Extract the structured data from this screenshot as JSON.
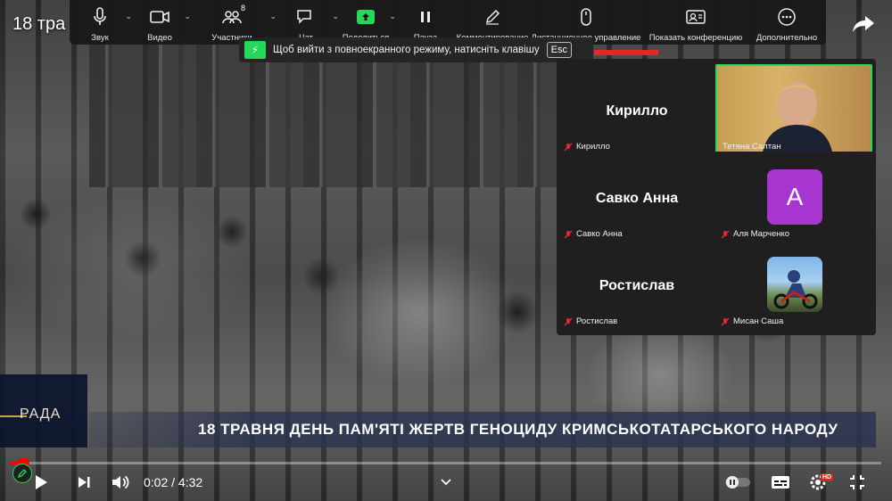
{
  "date_label": "18 тра",
  "toolbar": {
    "items": [
      {
        "label": "Звук",
        "icon": "microphone-icon"
      },
      {
        "label": "Видео",
        "icon": "camera-icon"
      },
      {
        "label": "Участники",
        "icon": "participants-icon",
        "badge": "8"
      },
      {
        "label": "Чат",
        "icon": "chat-icon"
      },
      {
        "label": "Поделиться",
        "icon": "share-screen-icon"
      },
      {
        "label": "Пауза",
        "icon": "pause-icon"
      },
      {
        "label": "Комментирование",
        "icon": "annotate-icon"
      },
      {
        "label": "Дистанционное управление",
        "icon": "remote-control-icon"
      },
      {
        "label": "Показать конференцию",
        "icon": "show-meeting-icon"
      },
      {
        "label": "Дополнительно",
        "icon": "more-icon"
      }
    ]
  },
  "fullscreen_hint": {
    "text": "Щоб вийти з повноекранного режиму, натисніть клавішу",
    "key": "Esc"
  },
  "participants": [
    {
      "display_name": "Кирилло",
      "caption": "Кирилло",
      "muted": true,
      "type": "name"
    },
    {
      "display_name": "",
      "caption": "Тетяна Салтан",
      "muted": false,
      "type": "video"
    },
    {
      "display_name": "Савко Анна",
      "caption": "Савко Анна",
      "muted": true,
      "type": "name"
    },
    {
      "display_name": "A",
      "caption": "Аля Марченко",
      "muted": true,
      "type": "avatar"
    },
    {
      "display_name": "Ростислав",
      "caption": "Ростислав",
      "muted": true,
      "type": "name"
    },
    {
      "display_name": "",
      "caption": "Мисан Саша",
      "muted": true,
      "type": "photo"
    }
  ],
  "lower_third": {
    "channel": "РАДА",
    "headline": "18 ТРАВНЯ ДЕНЬ ПАМ'ЯТІ ЖЕРТВ ГЕНОЦИДУ КРИМСЬКОТАТАРСЬКОГО НАРОДУ"
  },
  "player": {
    "current_time": "0:02",
    "duration": "4:32",
    "time_text": "0:02 / 4:32",
    "progress_fraction": 0.007,
    "hd": "HD",
    "accent_color": "#ff0000"
  },
  "colors": {
    "zoom_green": "#23d959",
    "avatar_purple": "#a736d1",
    "toolbar_bg": "#181818"
  }
}
